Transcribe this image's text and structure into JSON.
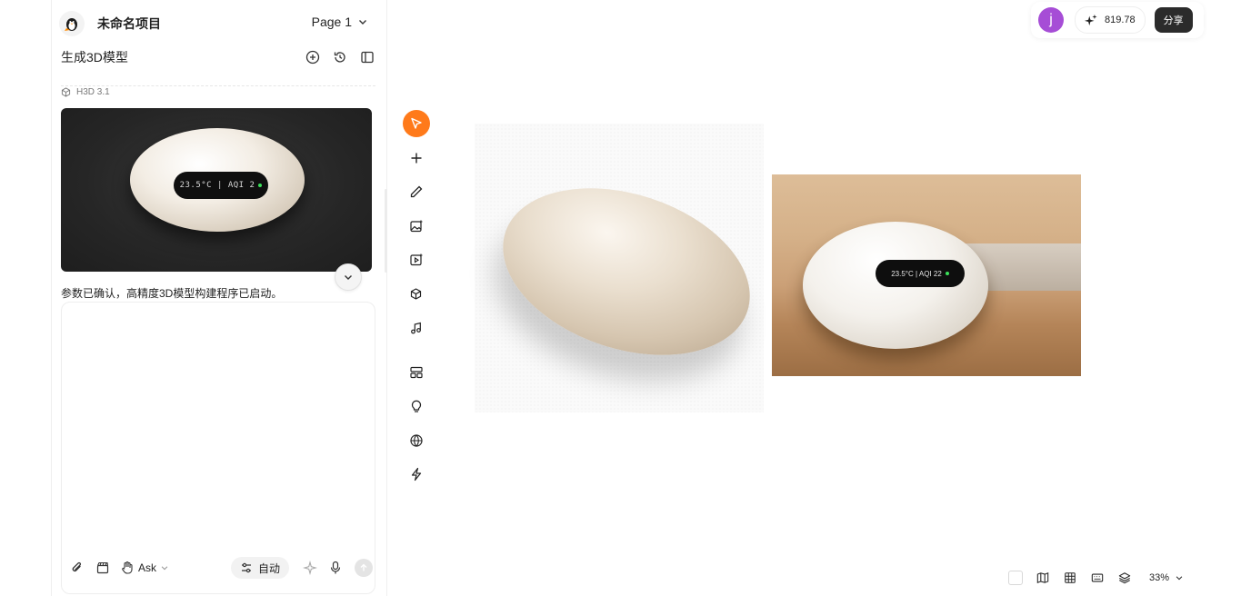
{
  "project": {
    "title": "未命名项目",
    "page_label": "Page 1"
  },
  "panel": {
    "heading": "生成3D模型",
    "model_tag": "H3D 3.1",
    "preview_screen_text": "23.5°C | AQI 2",
    "status_message": "参数已确认，高精度3D模型构建程序已启动。",
    "composer": {
      "placeholder": "",
      "mode_label": "Ask",
      "auto_label": "自动"
    }
  },
  "canvas": {
    "image2_screen_text": "23.5°C | AQI 22"
  },
  "topbar": {
    "avatar_letter": "j",
    "credits": "819.78",
    "share_label": "分享"
  },
  "bottombar": {
    "zoom": "33%"
  },
  "colors": {
    "accent": "#ff7a1a",
    "avatar": "#a64dd6",
    "share_bg": "#2b2b2b"
  },
  "icons": {
    "rail": [
      "select-icon",
      "add-icon",
      "pen-icon",
      "image-gen-icon",
      "video-gen-icon",
      "model-3d-icon",
      "music-icon",
      "layout-icon",
      "lightbulb-icon",
      "globe-icon",
      "lightning-icon"
    ]
  }
}
